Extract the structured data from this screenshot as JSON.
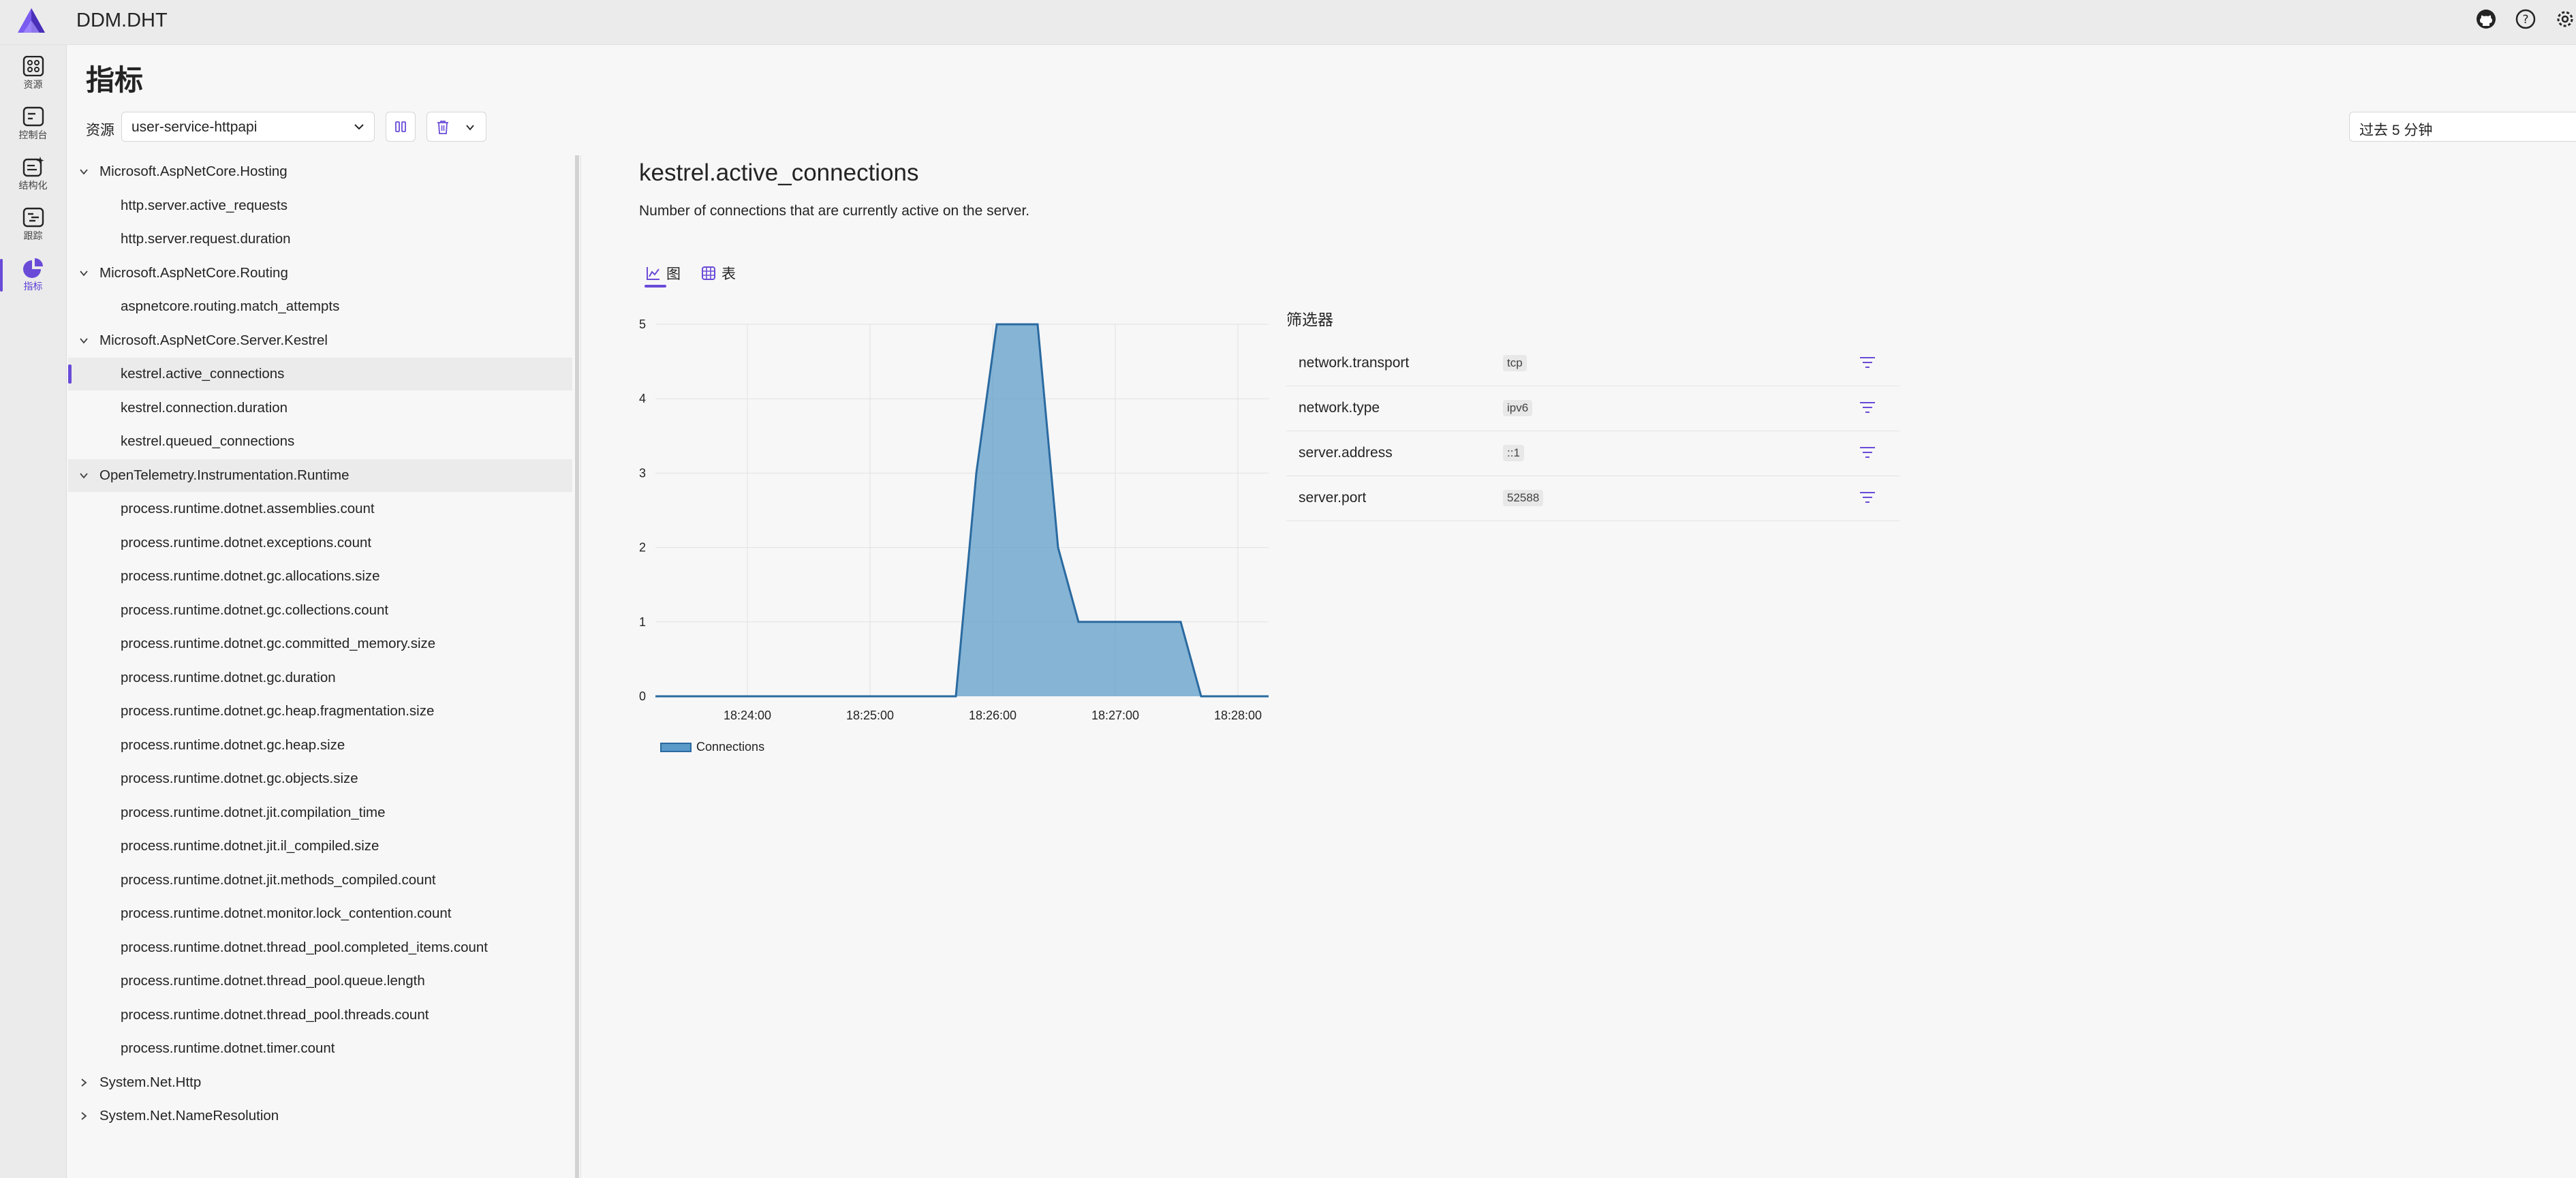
{
  "app": {
    "title": "DDM.DHT"
  },
  "header_icons": [
    "github-icon",
    "help-icon",
    "settings-icon"
  ],
  "nav": {
    "items": [
      {
        "label": "资源",
        "icon": "resources-icon"
      },
      {
        "label": "控制台",
        "icon": "console-icon"
      },
      {
        "label": "结构化",
        "icon": "structured-icon"
      },
      {
        "label": "跟踪",
        "icon": "traces-icon"
      },
      {
        "label": "指标",
        "icon": "metrics-icon",
        "active": true
      }
    ]
  },
  "page": {
    "title": "指标"
  },
  "toolbar": {
    "resource_label": "资源",
    "resource_value": "user-service-httpapi",
    "time_range": "过去 5 分钟"
  },
  "tree": {
    "groups": [
      {
        "name": "Microsoft.AspNetCore.Hosting",
        "expanded": true,
        "items": [
          "http.server.active_requests",
          "http.server.request.duration"
        ]
      },
      {
        "name": "Microsoft.AspNetCore.Routing",
        "expanded": true,
        "items": [
          "aspnetcore.routing.match_attempts"
        ]
      },
      {
        "name": "Microsoft.AspNetCore.Server.Kestrel",
        "expanded": true,
        "items": [
          "kestrel.active_connections",
          "kestrel.connection.duration",
          "kestrel.queued_connections"
        ]
      },
      {
        "name": "OpenTelemetry.Instrumentation.Runtime",
        "expanded": true,
        "items": [
          "process.runtime.dotnet.assemblies.count",
          "process.runtime.dotnet.exceptions.count",
          "process.runtime.dotnet.gc.allocations.size",
          "process.runtime.dotnet.gc.collections.count",
          "process.runtime.dotnet.gc.committed_memory.size",
          "process.runtime.dotnet.gc.duration",
          "process.runtime.dotnet.gc.heap.fragmentation.size",
          "process.runtime.dotnet.gc.heap.size",
          "process.runtime.dotnet.gc.objects.size",
          "process.runtime.dotnet.jit.compilation_time",
          "process.runtime.dotnet.jit.il_compiled.size",
          "process.runtime.dotnet.jit.methods_compiled.count",
          "process.runtime.dotnet.monitor.lock_contention.count",
          "process.runtime.dotnet.thread_pool.completed_items.count",
          "process.runtime.dotnet.thread_pool.queue.length",
          "process.runtime.dotnet.thread_pool.threads.count",
          "process.runtime.dotnet.timer.count"
        ]
      },
      {
        "name": "System.Net.Http",
        "expanded": false,
        "items": []
      },
      {
        "name": "System.Net.NameResolution",
        "expanded": false,
        "items": []
      }
    ],
    "selected": "kestrel.active_connections",
    "highlighted_group": "OpenTelemetry.Instrumentation.Runtime"
  },
  "metric": {
    "title": "kestrel.active_connections",
    "description": "Number of connections that are currently active on the server.",
    "tabs": [
      {
        "label": "图",
        "icon": "chart-icon",
        "active": true
      },
      {
        "label": "表",
        "icon": "table-icon"
      }
    ]
  },
  "chart_data": {
    "type": "area",
    "x_ticks": [
      "18:24:00",
      "18:25:00",
      "18:26:00",
      "18:27:00",
      "18:28:00"
    ],
    "y_ticks": [
      0,
      1,
      2,
      3,
      4,
      5
    ],
    "ylim": [
      0,
      5
    ],
    "xlim_minutes": [
      23.25,
      28.25
    ],
    "grid": true,
    "legend_position": "bottom-left",
    "series": [
      {
        "name": "Connections",
        "color": "#5a9ac8",
        "points": [
          [
            "18:23:15",
            0
          ],
          [
            "18:25:42",
            0
          ],
          [
            "18:25:52",
            3
          ],
          [
            "18:26:02",
            5
          ],
          [
            "18:26:22",
            5
          ],
          [
            "18:26:32",
            2
          ],
          [
            "18:26:42",
            1
          ],
          [
            "18:27:22",
            1
          ],
          [
            "18:27:32",
            1
          ],
          [
            "18:27:42",
            0
          ],
          [
            "18:28:15",
            0
          ]
        ]
      }
    ]
  },
  "filters": {
    "title": "筛选器",
    "rows": [
      {
        "name": "network.transport",
        "value": "tcp"
      },
      {
        "name": "network.type",
        "value": "ipv6"
      },
      {
        "name": "server.address",
        "value": "::1"
      },
      {
        "name": "server.port",
        "value": "52588"
      }
    ]
  },
  "colors": {
    "accent": "#6a4bd8",
    "series": "#5a9ac8",
    "series_line": "#2a6aa0"
  }
}
